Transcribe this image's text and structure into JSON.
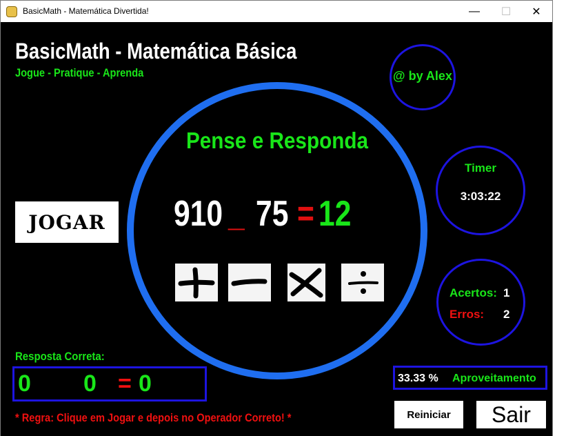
{
  "window": {
    "title": "BasicMath - Matemática Divertida!",
    "app_icon": "python-snake-icon",
    "minimize_glyph": "—",
    "maximize_glyph": "☐",
    "close_glyph": "✕"
  },
  "header": {
    "title": "BasicMath - Matemática Básica",
    "subtitle": "Jogue - Pratique - Aprenda"
  },
  "author": {
    "label": "@ by Alex"
  },
  "timer": {
    "label": "Timer",
    "value": "3:03:22"
  },
  "question": {
    "prompt": "Pense e Responda",
    "operand_a": "910",
    "blank": "_",
    "operand_b": "75",
    "equals": "=",
    "result": "12"
  },
  "operators": [
    {
      "name": "plus",
      "icon": "plus-icon"
    },
    {
      "name": "minus",
      "icon": "minus-icon"
    },
    {
      "name": "multiply",
      "icon": "multiply-icon"
    },
    {
      "name": "divide",
      "icon": "divide-icon"
    }
  ],
  "play_button": {
    "label": "JOGAR"
  },
  "score": {
    "hits_label": "Acertos:",
    "hits": "1",
    "errors_label": "Erros:",
    "errors": "2"
  },
  "correct_answer": {
    "title": "Resposta Correta:",
    "operand_a": "0",
    "operand_b": "0",
    "equals": "=",
    "result": "0"
  },
  "performance": {
    "value": "33.33 %",
    "label": "Aproveitamento"
  },
  "rule": "* Regra: Clique em Jogar e depois no Operador Correto! *",
  "buttons": {
    "restart": "Reiniciar",
    "quit": "Sair"
  },
  "colors": {
    "background": "#000000",
    "accent_green": "#19e619",
    "accent_red": "#f01010",
    "circle_blue": "#1f6ef0",
    "border_blue": "#1d14e0"
  }
}
